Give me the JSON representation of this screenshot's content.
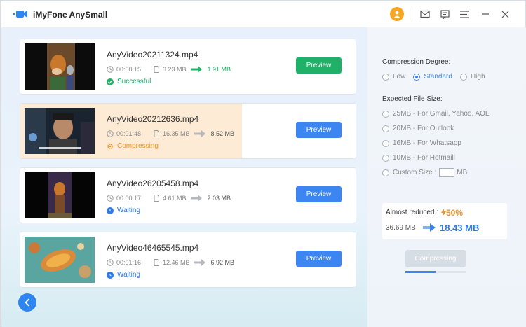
{
  "app": {
    "title": "iMyFone AnySmall"
  },
  "colors": {
    "accent": "#3d85f0",
    "success": "#21b068",
    "warning": "#f0932b",
    "compress_disabled": "#d7dde4"
  },
  "videos": [
    {
      "name": "AnyVideo20211324.mp4",
      "duration": "00:00:15",
      "size_before": "3.23 MB",
      "size_after": "1.91 MB",
      "status": "Successful",
      "status_type": "success",
      "preview_label": "Preview"
    },
    {
      "name": "AnyVideo20212636.mp4",
      "duration": "00:01:48",
      "size_before": "16.35 MB",
      "size_after": "8.52 MB",
      "status": "Compressing",
      "status_type": "compressing",
      "preview_label": "Preview"
    },
    {
      "name": "AnyVideo26205458.mp4",
      "duration": "00:00:17",
      "size_before": "4.61 MB",
      "size_after": "2.03 MB",
      "status": "Waiting",
      "status_type": "waiting",
      "preview_label": "Preview"
    },
    {
      "name": "AnyVideo46465545.mp4",
      "duration": "00:01:16",
      "size_before": "12.46 MB",
      "size_after": "6.92 MB",
      "status": "Waiting",
      "status_type": "waiting",
      "preview_label": "Preview"
    }
  ],
  "settings": {
    "degree_label": "Compression Degree:",
    "degree_options": [
      "Low",
      "Standard",
      "High"
    ],
    "degree_selected": "Standard",
    "size_label": "Expected File Size:",
    "size_options": [
      "25MB - For Gmail, Yahoo, AOL",
      "20MB - For Outlook",
      "16MB - For Whatsapp",
      "10MB - For Hotmaill"
    ],
    "custom_label": "Custom Size :",
    "custom_unit": "MB",
    "custom_value": ""
  },
  "summary": {
    "reduced_label": "Almost reduced :",
    "reduced_pct": "50%",
    "original_size": "36.69 MB",
    "new_size": "18.43 MB"
  },
  "compress": {
    "label": "Compressing",
    "progress": 0.5
  }
}
